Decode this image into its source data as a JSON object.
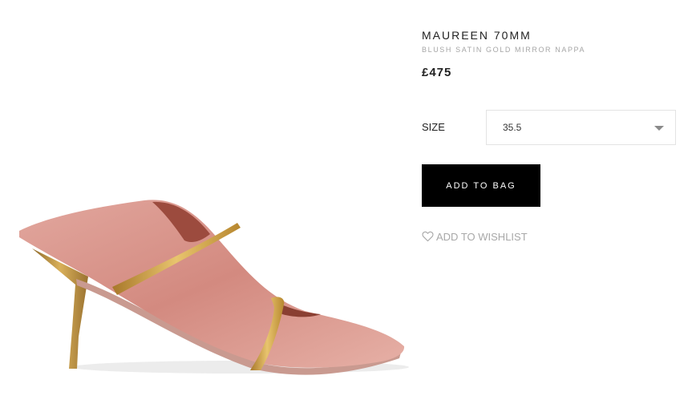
{
  "product": {
    "name": "MAUREEN 70MM",
    "description": "BLUSH SATIN GOLD MIRROR NAPPA",
    "price": "£475",
    "image_icon": "blush-satin-mule-image"
  },
  "size_selector": {
    "label": "SIZE",
    "selected_value": "35.5",
    "icon": "chevron-down-icon"
  },
  "actions": {
    "add_to_bag_label": "ADD TO BAG",
    "wishlist_label": "ADD TO WISHLIST",
    "wishlist_icon": "heart-icon"
  },
  "colors": {
    "satin": "#d9928a",
    "gold": "#c99a3e",
    "button_bg": "#000000"
  }
}
